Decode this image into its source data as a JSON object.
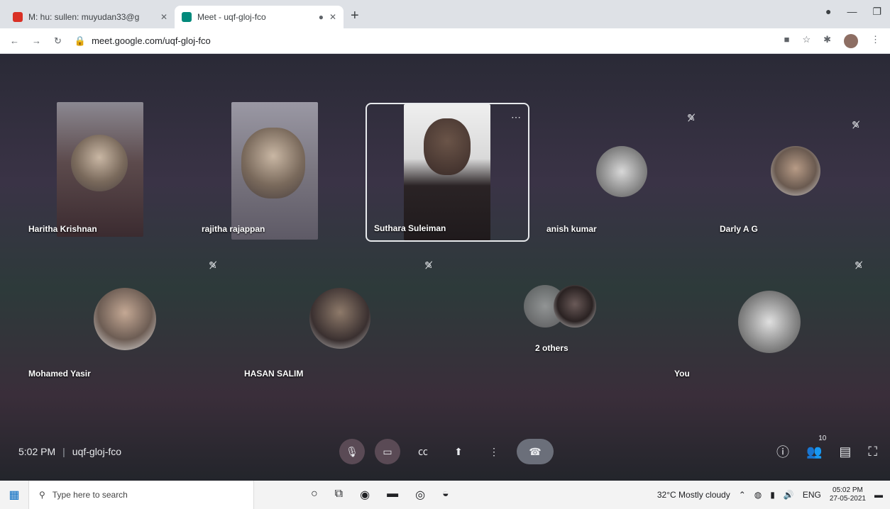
{
  "browser": {
    "tabs": [
      {
        "title": "M: hu: sullen: muyudan33@g",
        "active": false,
        "favicon_color": "#d93025"
      },
      {
        "title": "Meet - uqf-gloj-fco",
        "active": true,
        "favicon_color": "#00897b"
      }
    ],
    "address": "meet.google.com/uqf-gloj-fco"
  },
  "meet": {
    "participants": [
      {
        "name": "Haritha Krishnan"
      },
      {
        "name": "rajitha rajappan"
      },
      {
        "name": "Suthara Suleiman"
      },
      {
        "name": "anish kumar"
      },
      {
        "name": "Darly A G"
      },
      {
        "name": "Mohamed Yasir"
      },
      {
        "name": "HASAN SALIM"
      },
      {
        "name": "2 others"
      },
      {
        "name": "You"
      }
    ],
    "time": "5:02 PM",
    "separator": "|",
    "meeting_code": "uqf-gloj-fco",
    "people_count": "10"
  },
  "taskbar": {
    "search_placeholder": "Type here to search",
    "weather": "32°C  Mostly cloudy",
    "lang": "ENG",
    "clock_time": "05:02 PM",
    "clock_date": "27-05-2021"
  }
}
